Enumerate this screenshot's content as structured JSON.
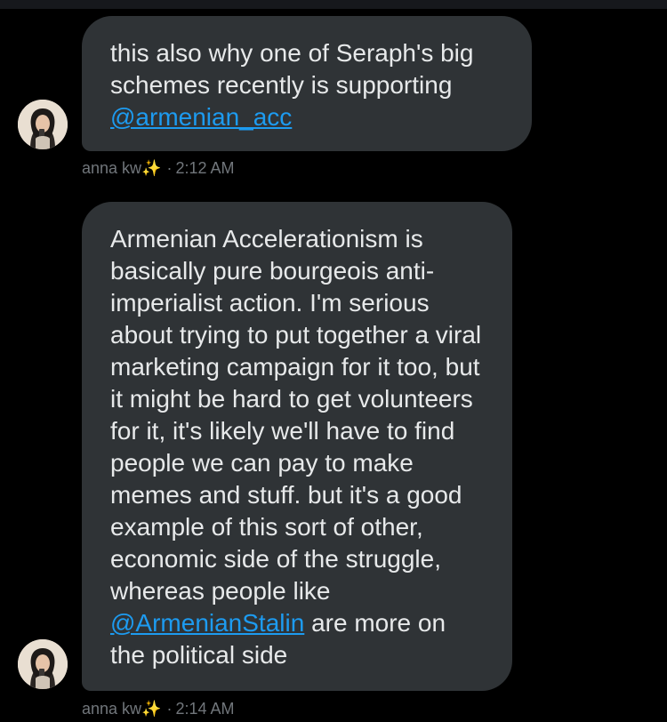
{
  "messages": [
    {
      "segments": [
        {
          "type": "text",
          "text": "this also why one of Seraph's big schemes recently is supporting "
        },
        {
          "type": "mention",
          "text": "@armenian_acc"
        }
      ],
      "sender": "anna kw",
      "sender_icon": "sparkles-icon",
      "sparkle_glyph": "✨",
      "separator": "·",
      "time": "2:12 AM"
    },
    {
      "segments": [
        {
          "type": "text",
          "text": "Armenian Accelerationism is basically pure bourgeois anti-imperialist action. I'm serious about trying to put together a viral marketing campaign for it too, but it might be hard to get volunteers for it, it's likely we'll have to find people we can pay to make memes and stuff. but it's a good example of this sort of other, economic side of the struggle, whereas people like "
        },
        {
          "type": "mention",
          "text": "@ArmenianStalin"
        },
        {
          "type": "text",
          "text": " are more on the political side"
        }
      ],
      "sender": "anna kw",
      "sender_icon": "sparkles-icon",
      "sparkle_glyph": "✨",
      "separator": "·",
      "time": "2:14 AM"
    }
  ],
  "colors": {
    "background": "#000000",
    "bubble": "#2f3336",
    "text": "#e7e9ea",
    "mention": "#1d9bf0",
    "meta": "#71767b"
  }
}
